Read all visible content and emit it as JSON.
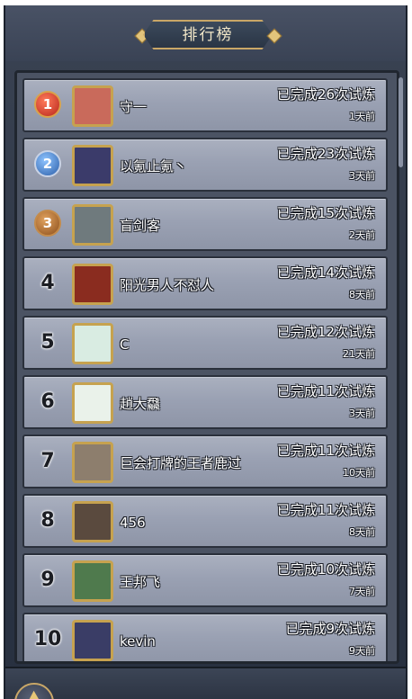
{
  "title": "排行榜",
  "rows": [
    {
      "rank": "1",
      "name": "守一",
      "completed": "已完成26次试炼",
      "time": "1天前",
      "avatar_color": "#c96a5b",
      "medal": "medal-1"
    },
    {
      "rank": "2",
      "name": "以氪止氪丶",
      "completed": "已完成23次试炼",
      "time": "3天前",
      "avatar_color": "#3b3b6a",
      "medal": "medal-2"
    },
    {
      "rank": "3",
      "name": "盲剑客",
      "completed": "已完成15次试炼",
      "time": "2天前",
      "avatar_color": "#6f7a7d",
      "medal": "medal-3"
    },
    {
      "rank": "4",
      "name": "阳光男人不怼人",
      "completed": "已完成14次试炼",
      "time": "8天前",
      "avatar_color": "#8a2c1f"
    },
    {
      "rank": "5",
      "name": "C",
      "completed": "已完成12次试炼",
      "time": "21天前",
      "avatar_color": "#d9ece2"
    },
    {
      "rank": "6",
      "name": "趙大飝",
      "completed": "已完成11次试炼",
      "time": "3天前",
      "avatar_color": "#eaf2ea"
    },
    {
      "rank": "7",
      "name": "巨会打牌的王者鹿过",
      "completed": "已完成11次试炼",
      "time": "10天前",
      "avatar_color": "#8d7e6d"
    },
    {
      "rank": "8",
      "name": "456",
      "completed": "已完成11次试炼",
      "time": "8天前",
      "avatar_color": "#5a4a3e"
    },
    {
      "rank": "9",
      "name": "王邦飞",
      "completed": "已完成10次试炼",
      "time": "7天前",
      "avatar_color": "#4f7a4d"
    },
    {
      "rank": "10",
      "name": "kevin",
      "completed": "已完成9次试炼",
      "time": "9天前",
      "avatar_color": "#3a3d66"
    }
  ],
  "icons": {
    "back": "back-arrow-icon",
    "medal": "rank-medal-icon",
    "avatar": "player-avatar"
  }
}
